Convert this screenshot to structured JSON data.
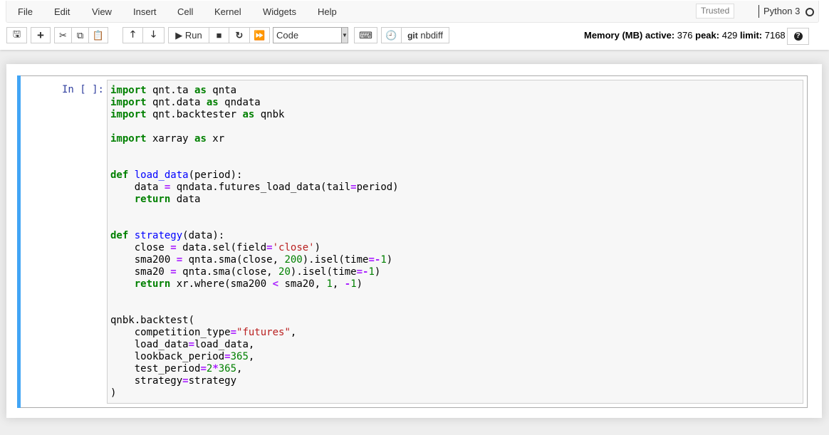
{
  "menubar": {
    "items": [
      "File",
      "Edit",
      "View",
      "Insert",
      "Cell",
      "Kernel",
      "Widgets",
      "Help"
    ],
    "trusted": "Trusted",
    "kernel": "Python 3"
  },
  "toolbar": {
    "run_label": "Run",
    "cell_type": "Code",
    "nbdiff_git": "git",
    "nbdiff_label": "nbdiff"
  },
  "memory": {
    "label": "Memory (MB)",
    "active_label": "active:",
    "active": "376",
    "peak_label": "peak:",
    "peak": "429",
    "limit_label": "limit:",
    "limit": "7168"
  },
  "cell": {
    "prompt": "In [ ]:",
    "lines": [
      [
        [
          "k",
          "import"
        ],
        [
          "n",
          " qnt.ta "
        ],
        [
          "k",
          "as"
        ],
        [
          "n",
          " qnta"
        ]
      ],
      [
        [
          "k",
          "import"
        ],
        [
          "n",
          " qnt.data "
        ],
        [
          "k",
          "as"
        ],
        [
          "n",
          " qndata"
        ]
      ],
      [
        [
          "k",
          "import"
        ],
        [
          "n",
          " qnt.backtester "
        ],
        [
          "k",
          "as"
        ],
        [
          "n",
          " qnbk"
        ]
      ],
      [],
      [
        [
          "k",
          "import"
        ],
        [
          "n",
          " xarray "
        ],
        [
          "k",
          "as"
        ],
        [
          "n",
          " xr"
        ]
      ],
      [],
      [],
      [
        [
          "k",
          "def"
        ],
        [
          "n",
          " "
        ],
        [
          "f",
          "load_data"
        ],
        [
          "n",
          "(period):"
        ]
      ],
      [
        [
          "n",
          "    data "
        ],
        [
          "o",
          "="
        ],
        [
          "n",
          " qndata.futures_load_data(tail"
        ],
        [
          "o",
          "="
        ],
        [
          "n",
          "period)"
        ]
      ],
      [
        [
          "n",
          "    "
        ],
        [
          "k",
          "return"
        ],
        [
          "n",
          " data"
        ]
      ],
      [],
      [],
      [
        [
          "k",
          "def"
        ],
        [
          "n",
          " "
        ],
        [
          "f",
          "strategy"
        ],
        [
          "n",
          "(data):"
        ]
      ],
      [
        [
          "n",
          "    close "
        ],
        [
          "o",
          "="
        ],
        [
          "n",
          " data.sel(field"
        ],
        [
          "o",
          "="
        ],
        [
          "s",
          "'close'"
        ],
        [
          "n",
          ")"
        ]
      ],
      [
        [
          "n",
          "    sma200 "
        ],
        [
          "o",
          "="
        ],
        [
          "n",
          " qnta.sma(close, "
        ],
        [
          "m",
          "200"
        ],
        [
          "n",
          ").isel(time"
        ],
        [
          "o",
          "=-"
        ],
        [
          "m",
          "1"
        ],
        [
          "n",
          ")"
        ]
      ],
      [
        [
          "n",
          "    sma20 "
        ],
        [
          "o",
          "="
        ],
        [
          "n",
          " qnta.sma(close, "
        ],
        [
          "m",
          "20"
        ],
        [
          "n",
          ").isel(time"
        ],
        [
          "o",
          "=-"
        ],
        [
          "m",
          "1"
        ],
        [
          "n",
          ")"
        ]
      ],
      [
        [
          "n",
          "    "
        ],
        [
          "k",
          "return"
        ],
        [
          "n",
          " xr.where(sma200 "
        ],
        [
          "o",
          "<"
        ],
        [
          "n",
          " sma20, "
        ],
        [
          "m",
          "1"
        ],
        [
          "n",
          ", "
        ],
        [
          "o",
          "-"
        ],
        [
          "m",
          "1"
        ],
        [
          "n",
          ")"
        ]
      ],
      [],
      [],
      [
        [
          "n",
          "qnbk.backtest("
        ]
      ],
      [
        [
          "n",
          "    competition_type"
        ],
        [
          "o",
          "="
        ],
        [
          "s",
          "\"futures\""
        ],
        [
          "n",
          ","
        ]
      ],
      [
        [
          "n",
          "    load_data"
        ],
        [
          "o",
          "="
        ],
        [
          "n",
          "load_data,"
        ]
      ],
      [
        [
          "n",
          "    lookback_period"
        ],
        [
          "o",
          "="
        ],
        [
          "m",
          "365"
        ],
        [
          "n",
          ","
        ]
      ],
      [
        [
          "n",
          "    test_period"
        ],
        [
          "o",
          "="
        ],
        [
          "m",
          "2"
        ],
        [
          "o",
          "*"
        ],
        [
          "m",
          "365"
        ],
        [
          "n",
          ","
        ]
      ],
      [
        [
          "n",
          "    strategy"
        ],
        [
          "o",
          "="
        ],
        [
          "n",
          "strategy"
        ]
      ],
      [
        [
          "n",
          ")"
        ]
      ]
    ]
  }
}
